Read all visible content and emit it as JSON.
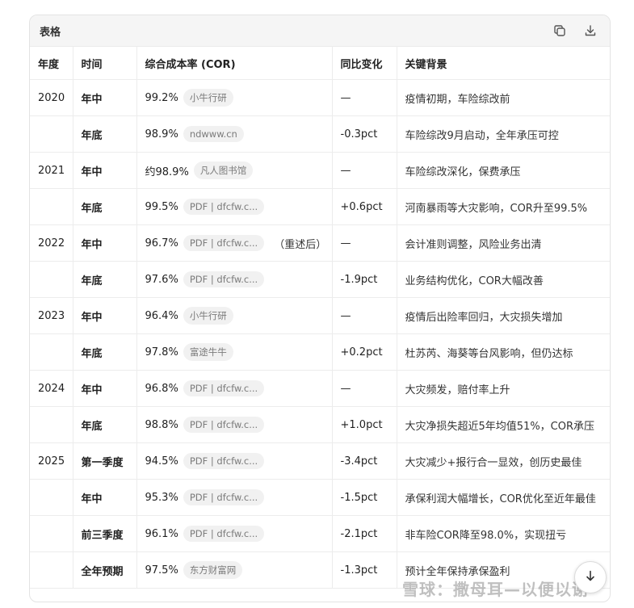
{
  "card": {
    "title": "表格",
    "icons": [
      "copy-icon",
      "download-icon"
    ]
  },
  "table": {
    "headers": [
      "年度",
      "时间",
      "综合成本率 (COR)",
      "同比变化",
      "关键背景"
    ],
    "rows": [
      {
        "year": "2020",
        "time": "年中",
        "cor": "99.2%",
        "source": "小牛行研",
        "note": "",
        "change": "—",
        "background": "疫情初期，车险综改前"
      },
      {
        "year": "",
        "time": "年底",
        "cor": "98.9%",
        "source": "ndwww.cn",
        "note": "",
        "change": "-0.3pct",
        "background": "车险综改9月启动，全年承压可控"
      },
      {
        "year": "2021",
        "time": "年中",
        "cor": "约98.9%",
        "source": "凡人图书馆",
        "note": "",
        "change": "—",
        "background": "车险综改深化，保费承压"
      },
      {
        "year": "",
        "time": "年底",
        "cor": "99.5%",
        "source": "PDF | dfcfw.c...",
        "note": "",
        "change": "+0.6pct",
        "background": "河南暴雨等大灾影响，COR升至99.5%"
      },
      {
        "year": "2022",
        "time": "年中",
        "cor": "96.7%",
        "source": "PDF | dfcfw.c...",
        "note": "（重述后）",
        "change": "—",
        "background": "会计准则调整，风险业务出清"
      },
      {
        "year": "",
        "time": "年底",
        "cor": "97.6%",
        "source": "PDF | dfcfw.c...",
        "note": "",
        "change": "-1.9pct",
        "background": "业务结构优化，COR大幅改善"
      },
      {
        "year": "2023",
        "time": "年中",
        "cor": "96.4%",
        "source": "小牛行研",
        "note": "",
        "change": "—",
        "background": "疫情后出险率回归，大灾损失增加"
      },
      {
        "year": "",
        "time": "年底",
        "cor": "97.8%",
        "source": "富途牛牛",
        "note": "",
        "change": "+0.2pct",
        "background": "杜苏芮、海葵等台风影响，但仍达标"
      },
      {
        "year": "2024",
        "time": "年中",
        "cor": "96.8%",
        "source": "PDF | dfcfw.c...",
        "note": "",
        "change": "—",
        "background": "大灾频发，赔付率上升"
      },
      {
        "year": "",
        "time": "年底",
        "cor": "98.8%",
        "source": "PDF | dfcfw.c...",
        "note": "",
        "change": "+1.0pct",
        "background": "大灾净损失超近5年均值51%，COR承压"
      },
      {
        "year": "2025",
        "time": "第一季度",
        "cor": "94.5%",
        "source": "PDF | dfcfw.c...",
        "note": "",
        "change": "-3.4pct",
        "background": "大灾减少+报行合一显效，创历史最佳"
      },
      {
        "year": "",
        "time": "年中",
        "cor": "95.3%",
        "source": "PDF | dfcfw.c...",
        "note": "",
        "change": "-1.5pct",
        "background": "承保利润大幅增长，COR优化至近年最佳"
      },
      {
        "year": "",
        "time": "前三季度",
        "cor": "96.1%",
        "source": "PDF | dfcfw.c...",
        "note": "",
        "change": "-2.1pct",
        "background": "非车险COR降至98.0%，实现扭亏"
      },
      {
        "year": "",
        "time": "全年预期",
        "cor": "97.5%",
        "source": "东方财富网",
        "note": "",
        "change": "-1.3pct",
        "background": "预计全年保持承保盈利"
      }
    ]
  },
  "watermark": "雪球：撒母耳—以便以谢",
  "scroll_button": {
    "icon": "arrow-down-icon"
  }
}
